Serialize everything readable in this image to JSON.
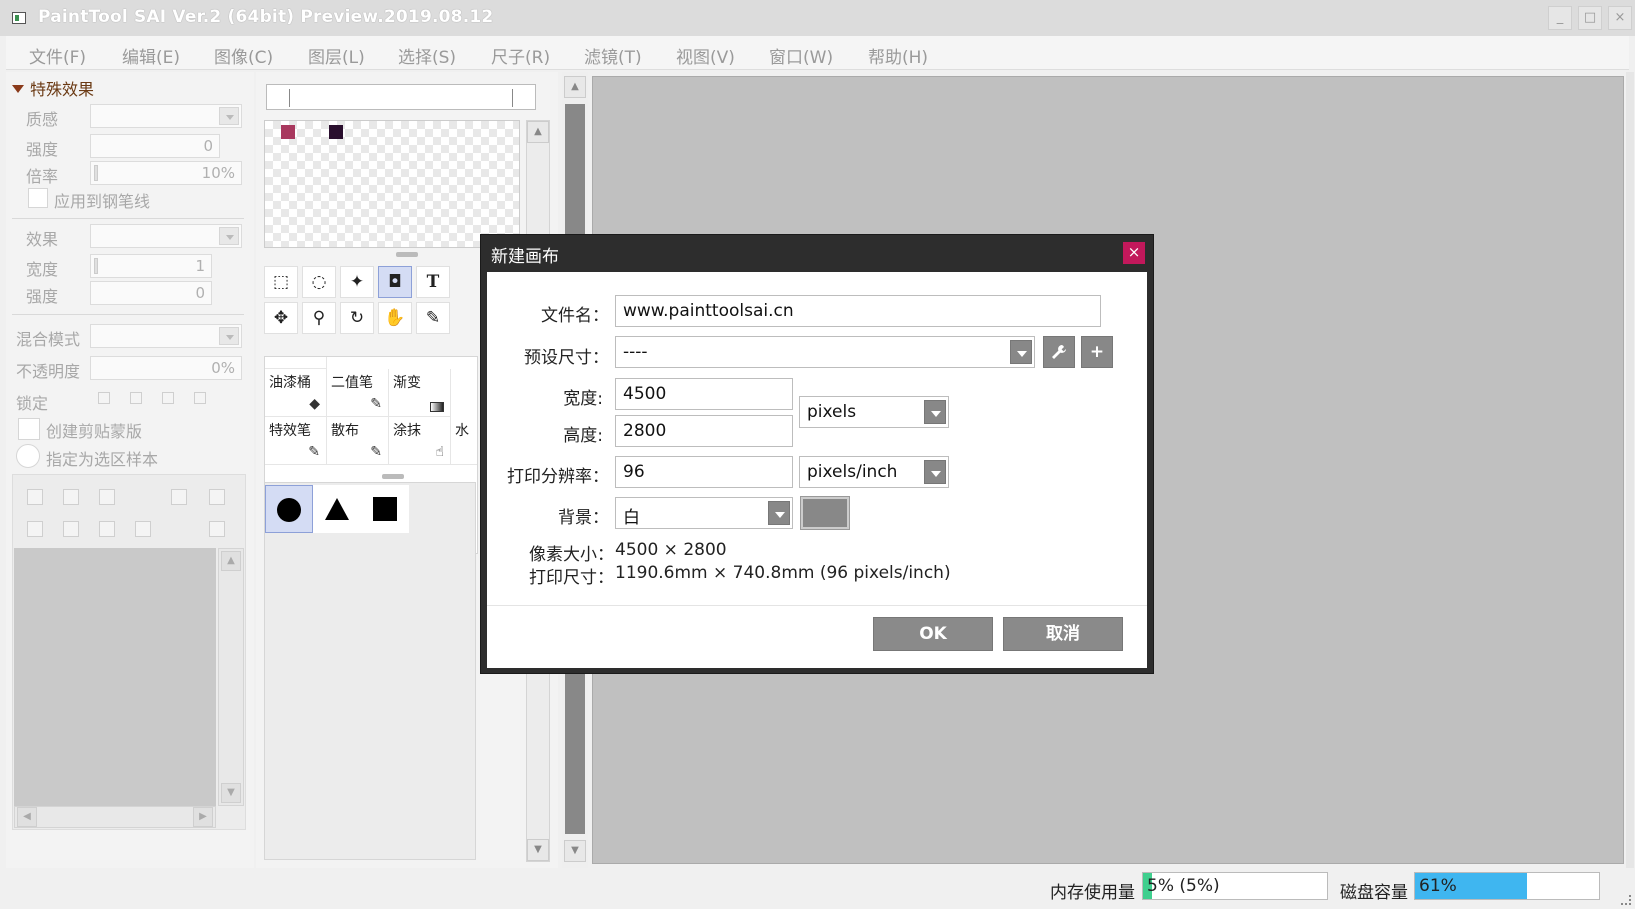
{
  "window": {
    "title": "PaintTool SAI Ver.2 (64bit) Preview.2019.08.12",
    "minimize": "_",
    "maximize": "□",
    "close": "×"
  },
  "menu": [
    "文件(F)",
    "编辑(E)",
    "图像(C)",
    "图层(L)",
    "选择(S)",
    "尺子(R)",
    "滤镜(T)",
    "视图(V)",
    "窗口(W)",
    "帮助(H)"
  ],
  "effects_panel": {
    "header": "特殊效果",
    "texture_label": "质感",
    "strength_label": "强度",
    "strength_value": "0",
    "ratio_label": "倍率",
    "ratio_value": "10%",
    "apply_to_pen_label": "应用到钢笔线",
    "effect_label": "效果",
    "width_label": "宽度",
    "width_value": "1",
    "strength2_label": "强度",
    "strength2_value": "0"
  },
  "layer_panel": {
    "blend_mode_label": "混合模式",
    "opacity_label": "不透明度",
    "opacity_value": "0%",
    "lock_label": "锁定",
    "clip_mask_label": "创建剪贴蒙版",
    "selection_source_label": "指定为选区样本"
  },
  "colors": {
    "swatch1": "#a8385e",
    "swatch2": "#2a0f2e",
    "memory_fill": "#3fcf8e",
    "disk_fill": "#3fb6f0",
    "dialog_close": "#c2185b"
  },
  "tools": {
    "row1": [
      "select-rect-icon",
      "lasso-icon",
      "magic-wand-icon",
      "shape-select-icon",
      "text-tool-icon"
    ],
    "row2": [
      "move-icon",
      "zoom-icon",
      "rotate-icon",
      "hand-icon",
      "eyedropper-icon"
    ],
    "text_tool_glyph": "T"
  },
  "brushes": {
    "row1": [
      "油漆桶",
      "二值笔",
      "渐变"
    ],
    "row2": [
      "特效笔",
      "散布",
      "涂抹"
    ],
    "partial": "水"
  },
  "shapes": [
    "circle-shape",
    "triangle-shape",
    "square-shape"
  ],
  "status": {
    "memory_label": "内存使用量",
    "memory_text": "5% (5%)",
    "memory_percent": 5,
    "disk_label": "磁盘容量",
    "disk_text": "61%",
    "disk_percent": 61
  },
  "dialog": {
    "title": "新建画布",
    "close": "×",
    "filename_label": "文件名：",
    "filename_value": "www.painttoolsai.cn",
    "preset_label": "预设尺寸：",
    "preset_value": "----",
    "wrench_icon": "wrench-icon",
    "add_label": "+",
    "width_label": "宽度:",
    "width_value": "4500",
    "height_label": "高度:",
    "height_value": "2800",
    "size_unit": "pixels",
    "resolution_label": "打印分辨率：",
    "resolution_value": "96",
    "resolution_unit": "pixels/inch",
    "background_label": "背景：",
    "background_value": "白",
    "background_color": "#888888",
    "pixel_size_label": "像素大小：",
    "pixel_size_value": "4500 × 2800",
    "print_size_label": "打印尺寸：",
    "print_size_value": "1190.6mm × 740.8mm (96 pixels/inch)",
    "ok_label": "OK",
    "cancel_label": "取消"
  }
}
